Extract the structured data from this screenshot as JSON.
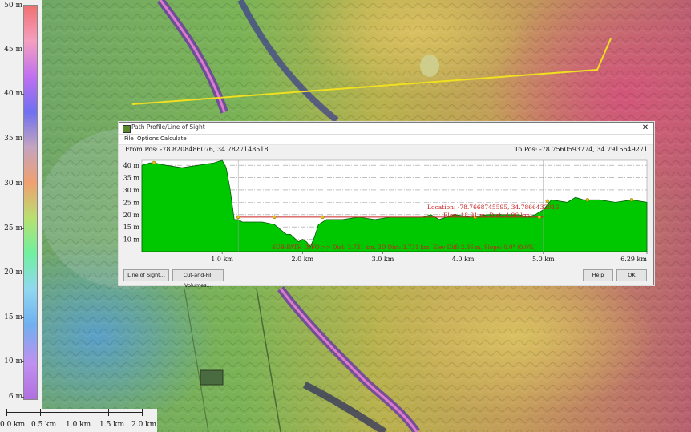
{
  "legend": {
    "labels": [
      "50 m",
      "45 m",
      "40 m",
      "35 m",
      "30 m",
      "25 m",
      "20 m",
      "15 m",
      "10 m",
      "6 m"
    ]
  },
  "scale_bar": {
    "labels": [
      "0.0 km",
      "0.5 km",
      "1.0 km",
      "1.5 km",
      "2.0 km"
    ]
  },
  "profile_window": {
    "title": "Path Profile/Line of Sight",
    "close_glyph": "✕",
    "menu": [
      "File",
      "Options",
      "Calculate"
    ],
    "from_pos": "From Pos: -78.8208486076, 34.7827148518",
    "to_pos": "To Pos: -78.7560593774, 34.7915649271",
    "location_line1": "Location: -78.7668745595, 34.7866432016",
    "location_line2": "Elev: 18.91 m, Dist: 4.96 km",
    "subpath_info": "SUB-PATH INFO >> Dist: 3.731 km, 3D Dist: 3.731 km, Elev Diff: 2.36 m, Slope: 0.0° (0.0%)",
    "buttons": {
      "line_of_sight": "Line of Sight...",
      "cut_fill": "Cut-and-Fill Volumes...",
      "help": "Help",
      "ok": "OK"
    }
  },
  "colors": {
    "profile_fill": "#00c800",
    "profile_stroke": "#0a5a0a",
    "red_line": "#c82020",
    "path_line": "#f0e020",
    "vertex_marker": "#e0c020"
  },
  "chart_data": {
    "type": "area",
    "xlabel": "",
    "ylabel": "",
    "x_tick_labels": [
      "1.0 km",
      "2.0 km",
      "3.0 km",
      "4.0 km",
      "5.0 km",
      "6.29 km"
    ],
    "x_ticks": [
      1.0,
      2.0,
      3.0,
      4.0,
      5.0,
      6.29
    ],
    "y_tick_labels": [
      "10 m",
      "15 m",
      "20 m",
      "25 m",
      "30 m",
      "35 m",
      "40 m"
    ],
    "y_ticks": [
      10,
      15,
      20,
      25,
      30,
      35,
      40
    ],
    "xlim": [
      0,
      6.29
    ],
    "ylim": [
      5,
      42
    ],
    "grid": true,
    "series": [
      {
        "x": [
          0.0,
          0.1,
          0.15,
          0.3,
          0.5,
          0.7,
          0.9,
          1.0,
          1.05,
          1.1,
          1.15,
          1.2,
          1.25,
          1.35,
          1.5,
          1.65,
          1.8,
          1.85,
          1.95,
          2.0,
          2.05,
          2.1,
          2.15,
          2.2,
          2.3,
          2.5,
          2.7,
          2.9,
          3.1,
          3.3,
          3.5,
          3.6,
          3.7,
          3.9,
          4.1,
          4.3,
          4.5,
          4.7,
          4.8,
          4.9,
          5.0,
          5.1,
          5.3,
          5.4,
          5.5,
          5.7,
          5.9,
          6.1,
          6.29
        ],
        "values": [
          40,
          41,
          41,
          40,
          39,
          40,
          41,
          42,
          39,
          30,
          18,
          18,
          17,
          17,
          17,
          16,
          12,
          12,
          9,
          10,
          9,
          7,
          11,
          16,
          18,
          18,
          19,
          18,
          19,
          19,
          19,
          20,
          18,
          20,
          19,
          20,
          20,
          20,
          19,
          20,
          22,
          26,
          25,
          27,
          26,
          26,
          25,
          26,
          25
        ]
      }
    ],
    "los_line": {
      "x": [
        1.2,
        5.0
      ],
      "y": [
        19,
        19
      ]
    },
    "vertices": [
      {
        "x": 0.15,
        "y": 41
      },
      {
        "x": 1.2,
        "y": 19
      },
      {
        "x": 1.65,
        "y": 19
      },
      {
        "x": 2.25,
        "y": 19
      },
      {
        "x": 4.15,
        "y": 19
      },
      {
        "x": 4.95,
        "y": 19
      },
      {
        "x": 5.05,
        "y": 25.5
      },
      {
        "x": 5.55,
        "y": 26
      },
      {
        "x": 6.1,
        "y": 26
      }
    ],
    "selection_span": [
      1.2,
      5.0
    ]
  }
}
